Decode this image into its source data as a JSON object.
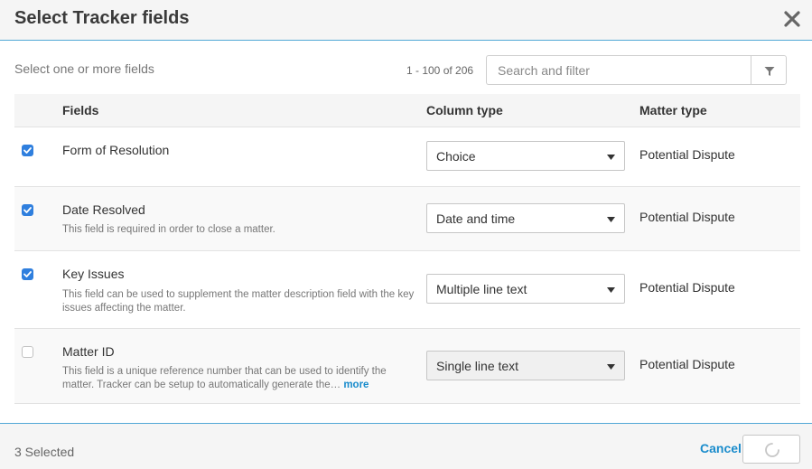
{
  "dialog": {
    "title": "Select Tracker fields"
  },
  "toolbar": {
    "hint": "Select one or more fields",
    "range": "1 - 100 of 206",
    "search_placeholder": "Search and filter"
  },
  "table": {
    "headers": {
      "fields": "Fields",
      "column_type": "Column type",
      "matter_type": "Matter type"
    },
    "rows": [
      {
        "checked": true,
        "name": "Form of Resolution",
        "description": "",
        "column_type": "Choice",
        "matter_type": "Potential Dispute"
      },
      {
        "checked": true,
        "name": "Date Resolved",
        "description": "This field is required in order to close a matter.",
        "column_type": "Date and time",
        "matter_type": "Potential Dispute"
      },
      {
        "checked": true,
        "name": "Key Issues",
        "description": "This field can be used to supplement the matter description field with the key issues affecting the matter.",
        "column_type": "Multiple line text",
        "matter_type": "Potential Dispute"
      },
      {
        "checked": false,
        "name": "Matter ID",
        "description": "This field is a unique reference number that can be used to identify the matter. Tracker can be setup to automatically generate the…",
        "more_label": "more",
        "column_type": "Single line text",
        "matter_type": "Potential Dispute"
      }
    ]
  },
  "footer": {
    "selected": "3 Selected",
    "cancel_label": "Cancel"
  },
  "colors": {
    "accent": "#52a8d6",
    "link": "#1a8ccc",
    "checkbox": "#2f7fde"
  },
  "icons": {
    "close": "close-icon",
    "filter": "filter-icon",
    "dropdown": "chevron-down-icon",
    "loading": "spinner-icon"
  }
}
